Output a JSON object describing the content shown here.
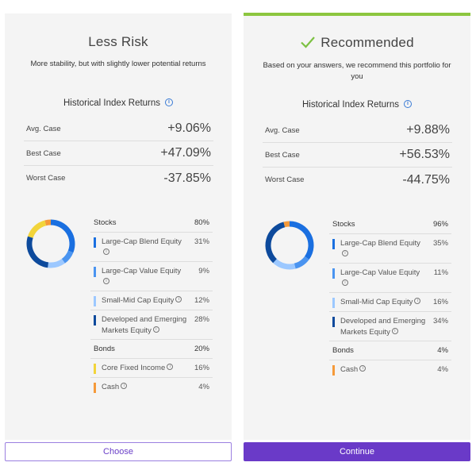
{
  "colors": {
    "large_cap_blend": "#1a6fe0",
    "large_cap_value": "#4a94f0",
    "small_mid_cap": "#9cc8ff",
    "developed_emerging": "#0d4a9c",
    "core_fixed_income": "#f2d43a",
    "cash": "#f59a3a",
    "recommended_bar": "#8cc63f",
    "info_icon": "#3a7bd5",
    "continue_button": "#6a3ac8"
  },
  "cards": [
    {
      "title": "Less Risk",
      "recommended": false,
      "subtitle": "More stability, but with slightly lower potential returns",
      "hist_label": "Historical Index Returns",
      "returns": [
        {
          "label": "Avg. Case",
          "value": "+9.06%"
        },
        {
          "label": "Best Case",
          "value": "+47.09%"
        },
        {
          "label": "Worst Case",
          "value": "-37.85%"
        }
      ],
      "groups": [
        {
          "label": "Stocks",
          "pct": "80%",
          "items": [
            {
              "label": "Large-Cap Blend Equity",
              "pct": "31%",
              "value": 31,
              "color_key": "large_cap_blend"
            },
            {
              "label": "Large-Cap Value Equity",
              "pct": "9%",
              "value": 9,
              "color_key": "large_cap_value"
            },
            {
              "label": "Small-Mid Cap Equity",
              "pct": "12%",
              "value": 12,
              "color_key": "small_mid_cap"
            },
            {
              "label": "Developed and Emerging Markets Equity",
              "pct": "28%",
              "value": 28,
              "color_key": "developed_emerging"
            }
          ]
        },
        {
          "label": "Bonds",
          "pct": "20%",
          "items": [
            {
              "label": "Core Fixed Income",
              "pct": "16%",
              "value": 16,
              "color_key": "core_fixed_income"
            },
            {
              "label": "Cash",
              "pct": "4%",
              "value": 4,
              "color_key": "cash"
            }
          ]
        }
      ],
      "button": "Choose"
    },
    {
      "title": "Recommended",
      "recommended": true,
      "subtitle": "Based on your answers, we recommend this portfolio for you",
      "hist_label": "Historical Index Returns",
      "returns": [
        {
          "label": "Avg. Case",
          "value": "+9.88%"
        },
        {
          "label": "Best Case",
          "value": "+56.53%"
        },
        {
          "label": "Worst Case",
          "value": "-44.75%"
        }
      ],
      "groups": [
        {
          "label": "Stocks",
          "pct": "96%",
          "items": [
            {
              "label": "Large-Cap Blend Equity",
              "pct": "35%",
              "value": 35,
              "color_key": "large_cap_blend"
            },
            {
              "label": "Large-Cap Value Equity",
              "pct": "11%",
              "value": 11,
              "color_key": "large_cap_value"
            },
            {
              "label": "Small-Mid Cap Equity",
              "pct": "16%",
              "value": 16,
              "color_key": "small_mid_cap"
            },
            {
              "label": "Developed and Emerging Markets Equity",
              "pct": "34%",
              "value": 34,
              "color_key": "developed_emerging"
            }
          ]
        },
        {
          "label": "Bonds",
          "pct": "4%",
          "items": [
            {
              "label": "Cash",
              "pct": "4%",
              "value": 4,
              "color_key": "cash"
            }
          ]
        }
      ],
      "button": "Continue"
    }
  ],
  "icons": {
    "info": "i",
    "check": "checkmark-icon"
  }
}
